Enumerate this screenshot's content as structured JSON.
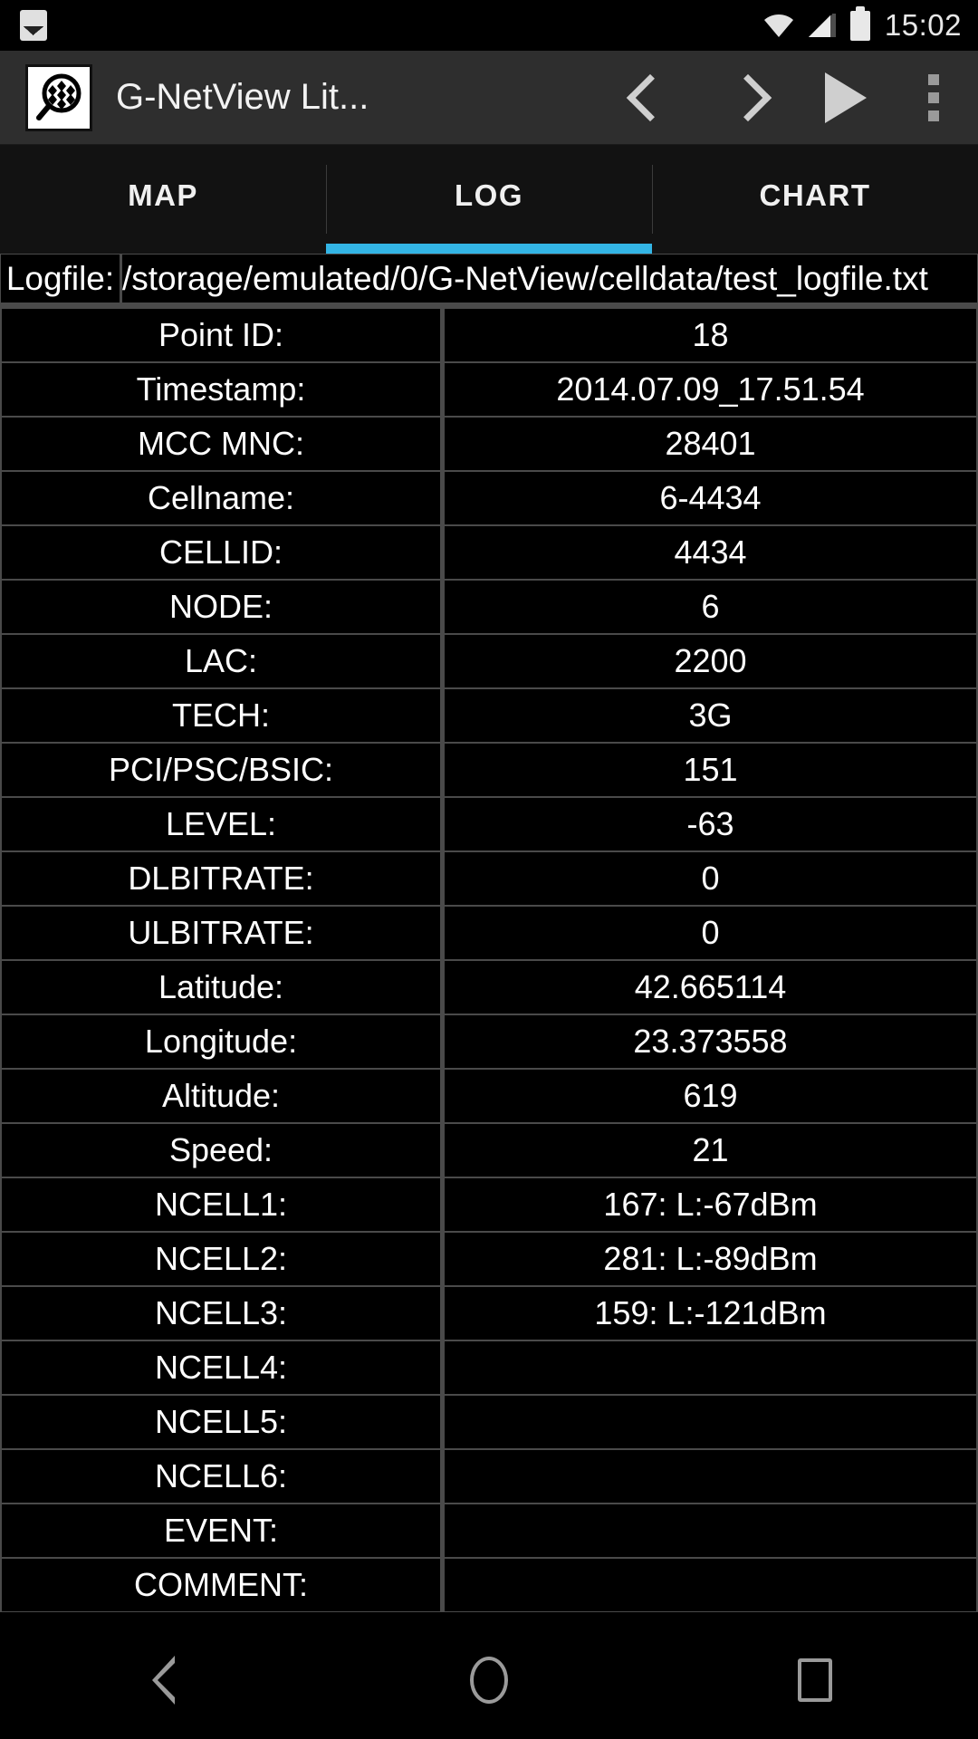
{
  "statusbar": {
    "time": "15:02",
    "icons": [
      "gallery-icon",
      "wifi-icon",
      "cell-signal-icon",
      "battery-icon"
    ]
  },
  "appbar": {
    "logo": "gnetview-logo-icon",
    "title": "G-NetView Lit...",
    "actions": [
      {
        "name": "previous-point-button",
        "icon": "chevron-left-icon"
      },
      {
        "name": "next-point-button",
        "icon": "chevron-right-icon"
      },
      {
        "name": "play-button",
        "icon": "play-icon"
      },
      {
        "name": "overflow-menu-button",
        "icon": "more-vert-icon"
      }
    ]
  },
  "tabs": [
    {
      "label": "MAP",
      "active": false
    },
    {
      "label": "LOG",
      "active": true
    },
    {
      "label": "CHART",
      "active": false
    }
  ],
  "accent_color": "#33b5e5",
  "logfile": {
    "label": "Logfile:",
    "path": "/storage/emulated/0/G-NetView/celldata/test_logfile.txt"
  },
  "log_rows": [
    {
      "key": "Point ID:",
      "value": "18"
    },
    {
      "key": "Timestamp:",
      "value": "2014.07.09_17.51.54"
    },
    {
      "key": "MCC MNC:",
      "value": "28401"
    },
    {
      "key": "Cellname:",
      "value": "6-4434"
    },
    {
      "key": "CELLID:",
      "value": "4434"
    },
    {
      "key": "NODE:",
      "value": "6"
    },
    {
      "key": "LAC:",
      "value": "2200"
    },
    {
      "key": "TECH:",
      "value": "3G"
    },
    {
      "key": "PCI/PSC/BSIC:",
      "value": "151"
    },
    {
      "key": "LEVEL:",
      "value": "-63"
    },
    {
      "key": "DLBITRATE:",
      "value": "0"
    },
    {
      "key": "ULBITRATE:",
      "value": "0"
    },
    {
      "key": "Latitude:",
      "value": "42.665114"
    },
    {
      "key": "Longitude:",
      "value": "23.373558"
    },
    {
      "key": "Altitude:",
      "value": "619"
    },
    {
      "key": "Speed:",
      "value": "21"
    },
    {
      "key": "NCELL1:",
      "value": "167:  L:-67dBm"
    },
    {
      "key": "NCELL2:",
      "value": "281:  L:-89dBm"
    },
    {
      "key": "NCELL3:",
      "value": "159:  L:-121dBm"
    },
    {
      "key": "NCELL4:",
      "value": ""
    },
    {
      "key": "NCELL5:",
      "value": ""
    },
    {
      "key": "NCELL6:",
      "value": ""
    },
    {
      "key": "EVENT:",
      "value": ""
    },
    {
      "key": "COMMENT:",
      "value": ""
    }
  ],
  "navbar": [
    {
      "name": "nav-back-button",
      "icon": "back-triangle-icon"
    },
    {
      "name": "nav-home-button",
      "icon": "home-circle-icon"
    },
    {
      "name": "nav-recents-button",
      "icon": "recents-square-icon"
    }
  ]
}
